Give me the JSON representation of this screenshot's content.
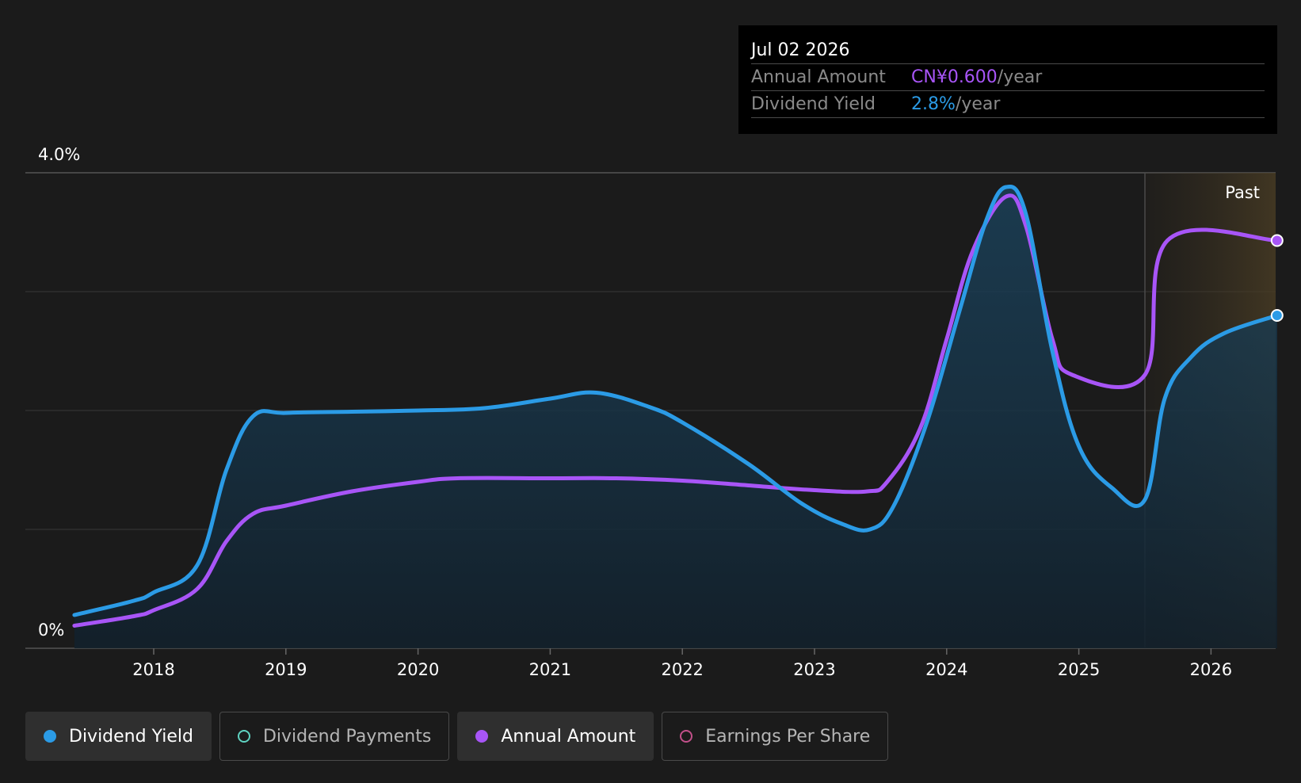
{
  "tooltip": {
    "date": "Jul 02 2026",
    "rows": [
      {
        "label": "Annual Amount",
        "value": "CN¥0.600",
        "unit": "/year",
        "color": "#a855f7"
      },
      {
        "label": "Dividend Yield",
        "value": "2.8%",
        "unit": "/year",
        "color": "#2b9be6"
      }
    ]
  },
  "legend": [
    {
      "label": "Dividend Yield",
      "color": "#2b9be6",
      "active": true,
      "icon": "filled-dot-icon"
    },
    {
      "label": "Dividend Payments",
      "color": "#5fd3c1",
      "active": false,
      "icon": "hollow-dot-icon"
    },
    {
      "label": "Annual Amount",
      "color": "#a855f7",
      "active": true,
      "icon": "filled-dot-icon"
    },
    {
      "label": "Earnings Per Share",
      "color": "#c2508a",
      "active": false,
      "icon": "hollow-dot-icon"
    }
  ],
  "chart_data": {
    "type": "line",
    "ylim": [
      0,
      4.0
    ],
    "y_ticks": [
      "0%",
      "4.0%"
    ],
    "x_ticks": [
      "2018",
      "2019",
      "2020",
      "2021",
      "2022",
      "2023",
      "2024",
      "2025",
      "2026"
    ],
    "xlim": [
      2017.4,
      2026.5
    ],
    "grid": true,
    "forecast_start": 2025.5,
    "forecast_label": "Past",
    "series": [
      {
        "name": "Dividend Yield",
        "color": "#2b9be6",
        "area": true,
        "points": [
          [
            2017.4,
            0.28
          ],
          [
            2017.85,
            0.4
          ],
          [
            2018.0,
            0.47
          ],
          [
            2018.33,
            0.7
          ],
          [
            2018.55,
            1.5
          ],
          [
            2018.75,
            1.95
          ],
          [
            2019.0,
            1.98
          ],
          [
            2019.5,
            1.99
          ],
          [
            2020.0,
            2.0
          ],
          [
            2020.5,
            2.02
          ],
          [
            2021.0,
            2.1
          ],
          [
            2021.35,
            2.15
          ],
          [
            2021.75,
            2.03
          ],
          [
            2022.0,
            1.9
          ],
          [
            2022.5,
            1.55
          ],
          [
            2022.9,
            1.22
          ],
          [
            2023.2,
            1.05
          ],
          [
            2023.42,
            1.0
          ],
          [
            2023.6,
            1.2
          ],
          [
            2023.85,
            1.9
          ],
          [
            2024.1,
            2.85
          ],
          [
            2024.3,
            3.6
          ],
          [
            2024.45,
            3.88
          ],
          [
            2024.6,
            3.65
          ],
          [
            2024.8,
            2.5
          ],
          [
            2025.0,
            1.7
          ],
          [
            2025.25,
            1.35
          ],
          [
            2025.5,
            1.25
          ],
          [
            2025.65,
            2.1
          ],
          [
            2025.85,
            2.45
          ],
          [
            2026.1,
            2.65
          ],
          [
            2026.5,
            2.8
          ]
        ]
      },
      {
        "name": "Annual Amount",
        "color": "#a855f7",
        "area": false,
        "points": [
          [
            2017.4,
            0.19
          ],
          [
            2017.85,
            0.27
          ],
          [
            2018.0,
            0.32
          ],
          [
            2018.33,
            0.5
          ],
          [
            2018.55,
            0.9
          ],
          [
            2018.75,
            1.13
          ],
          [
            2019.0,
            1.2
          ],
          [
            2019.5,
            1.32
          ],
          [
            2020.0,
            1.4
          ],
          [
            2020.3,
            1.43
          ],
          [
            2021.0,
            1.43
          ],
          [
            2021.5,
            1.43
          ],
          [
            2022.0,
            1.41
          ],
          [
            2022.5,
            1.37
          ],
          [
            2023.0,
            1.33
          ],
          [
            2023.4,
            1.32
          ],
          [
            2023.55,
            1.4
          ],
          [
            2023.8,
            1.85
          ],
          [
            2024.0,
            2.6
          ],
          [
            2024.2,
            3.35
          ],
          [
            2024.45,
            3.8
          ],
          [
            2024.6,
            3.55
          ],
          [
            2024.8,
            2.6
          ],
          [
            2024.95,
            2.3
          ],
          [
            2025.5,
            2.3
          ],
          [
            2025.67,
            3.43
          ],
          [
            2026.5,
            3.43
          ]
        ]
      }
    ]
  }
}
